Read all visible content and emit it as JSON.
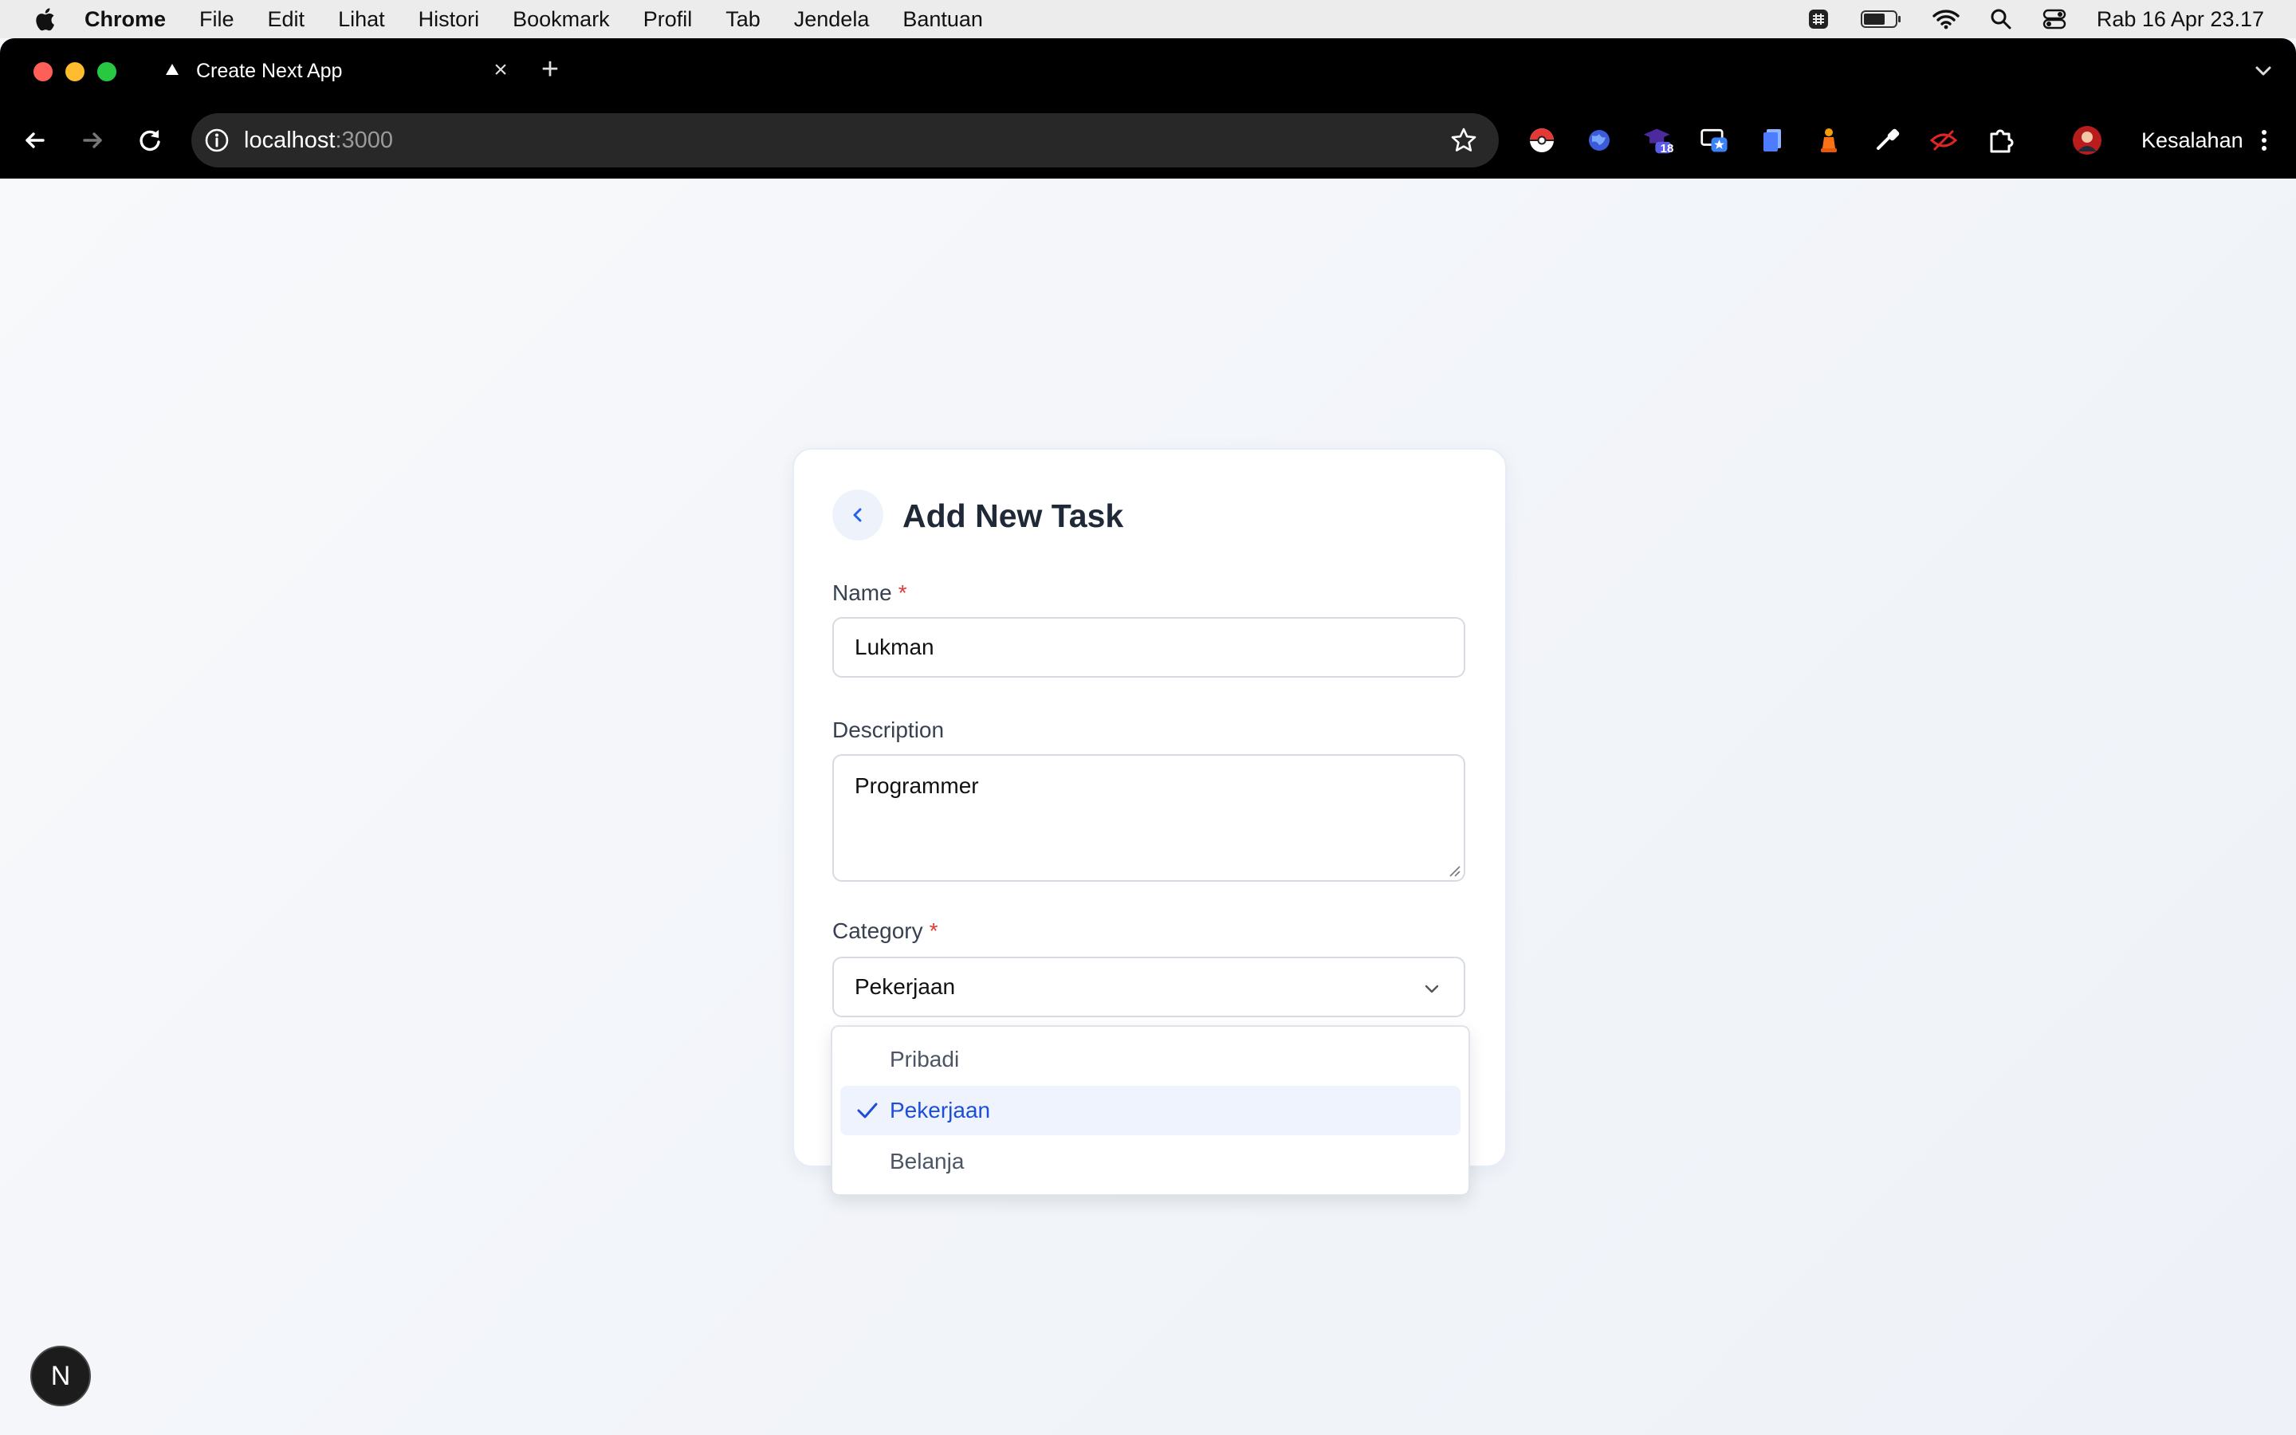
{
  "menubar": {
    "app_name": "Chrome",
    "items": [
      "File",
      "Edit",
      "Lihat",
      "Histori",
      "Bookmark",
      "Profil",
      "Tab",
      "Jendela",
      "Bantuan"
    ],
    "clock": "Rab 16 Apr  23.17"
  },
  "browser": {
    "tab_title": "Create Next App",
    "url_host": "localhost",
    "url_port": ":3000",
    "extension_badge": "18",
    "profile_label": "Kesalahan"
  },
  "form": {
    "title": "Add New Task",
    "name_label": "Name",
    "required_mark": "*",
    "name_value": "Lukman",
    "description_label": "Description",
    "description_value": "Programmer",
    "category_label": "Category",
    "category_value": "Pekerjaan"
  },
  "dropdown": {
    "options": [
      {
        "label": "Pribadi",
        "selected": false
      },
      {
        "label": "Pekerjaan",
        "selected": true
      },
      {
        "label": "Belanja",
        "selected": false
      }
    ]
  },
  "dev_badge": {
    "letter": "N"
  },
  "colors": {
    "accent": "#1d4ed8",
    "required": "#e53935",
    "selected_bg": "#eef3fd"
  }
}
